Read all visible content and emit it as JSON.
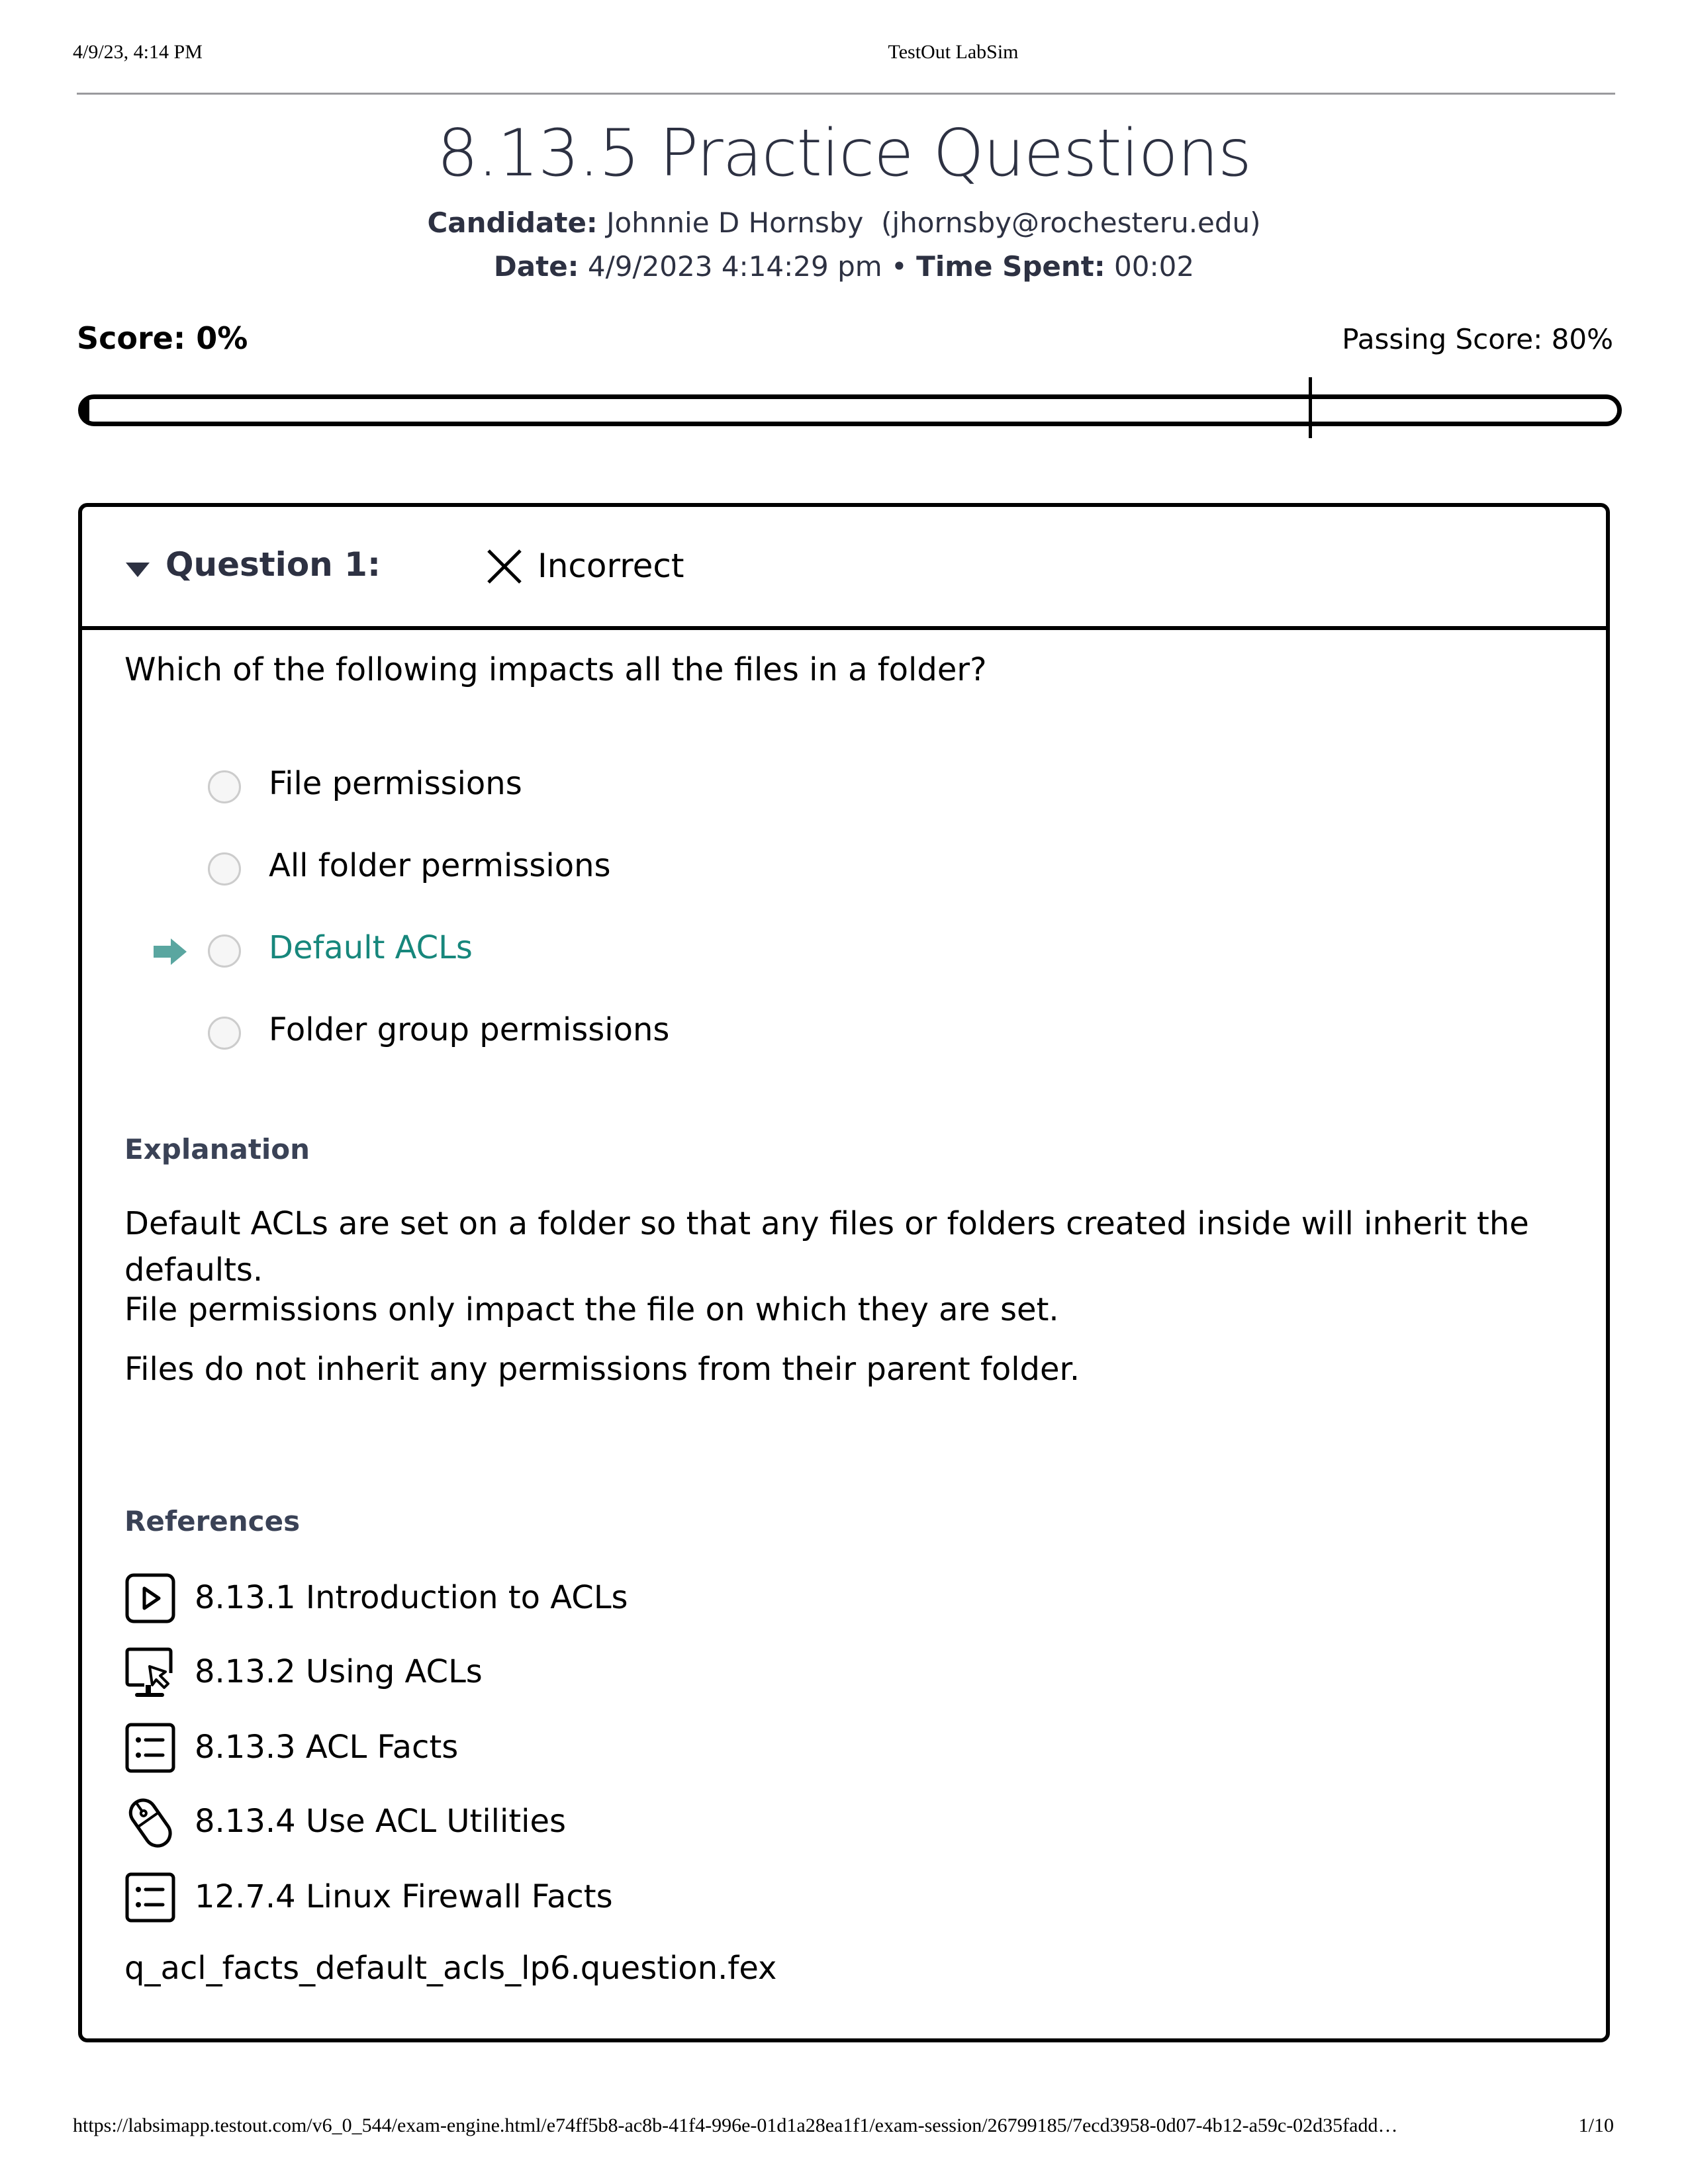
{
  "print_header": {
    "datetime": "4/9/23, 4:14 PM",
    "title": "TestOut LabSim"
  },
  "page": {
    "title": "8.13.5 Practice Questions",
    "candidate_label": "Candidate:",
    "candidate_value": "Johnnie D Hornsby  (jhornsby@rochesteru.edu)",
    "date_label": "Date:",
    "date_value": "4/9/2023 4:14:29 pm",
    "separator": "•",
    "time_label": "Time Spent:",
    "time_value": "00:02"
  },
  "score": {
    "label": "Score: 0%",
    "passing_label": "Passing Score: 80%",
    "score_percent": 0,
    "passing_percent": 80
  },
  "question": {
    "label": "Question 1:",
    "status_icon": "x-icon",
    "status": "Incorrect",
    "text": "Which of the following impacts all the files in a folder?",
    "answers": [
      {
        "label": "File permissions",
        "correct": false,
        "selected": false
      },
      {
        "label": "All folder permissions",
        "correct": false,
        "selected": false
      },
      {
        "label": "Default ACLs",
        "correct": true,
        "selected": false
      },
      {
        "label": "Folder group permissions",
        "correct": false,
        "selected": false
      }
    ],
    "explanation_heading": "Explanation",
    "explanation": [
      "Default ACLs are set on a folder so that any files or folders created inside will inherit the defaults.",
      "File permissions only impact the file on which they are set.",
      "Files do not inherit any permissions from their parent folder."
    ],
    "references_heading": "References",
    "references": [
      {
        "icon": "video-play-icon",
        "label": "8.13.1 Introduction to ACLs"
      },
      {
        "icon": "demo-monitor-icon",
        "label": "8.13.2 Using ACLs"
      },
      {
        "icon": "facts-list-icon",
        "label": "8.13.3 ACL Facts"
      },
      {
        "icon": "lab-mouse-icon",
        "label": "8.13.4 Use ACL Utilities"
      },
      {
        "icon": "facts-list-icon",
        "label": "12.7.4 Linux Firewall Facts"
      }
    ],
    "filename": "q_acl_facts_default_acls_lp6.question.fex"
  },
  "colors": {
    "correct_answer": "#17877c",
    "heading": "#2d3142"
  },
  "footer": {
    "url": "https://labsimapp.testout.com/v6_0_544/exam-engine.html/e74ff5b8-ac8b-41f4-996e-01d1a28ea1f1/exam-session/26799185/7ecd3958-0d07-4b12-a59c-02d35fadd…",
    "page": "1/10"
  }
}
